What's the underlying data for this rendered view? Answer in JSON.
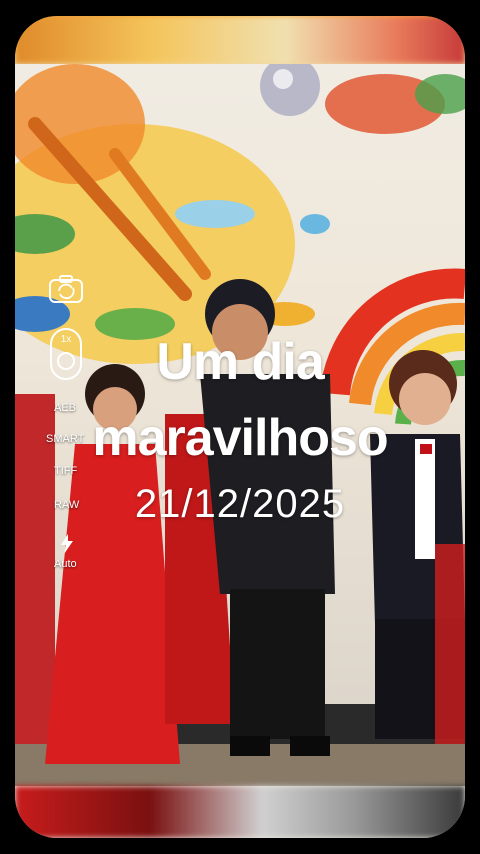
{
  "overlay": {
    "title_line1": "Um dia",
    "title_line2": "maravilhoso",
    "date": "21/12/2025"
  },
  "camera_controls": {
    "switch_camera_icon": "camera-switch-icon",
    "zoom_label": "1x",
    "aeb_label": "AEB",
    "smart_label": "SMART",
    "tiff_label": "TIFF",
    "raw_label": "RAW",
    "flash_icon": "flash-icon",
    "flash_label": "Auto"
  },
  "colors": {
    "dress_red": "#d81e1e",
    "rainbow_red": "#e3321f",
    "overlay_text": "#ffffff"
  }
}
